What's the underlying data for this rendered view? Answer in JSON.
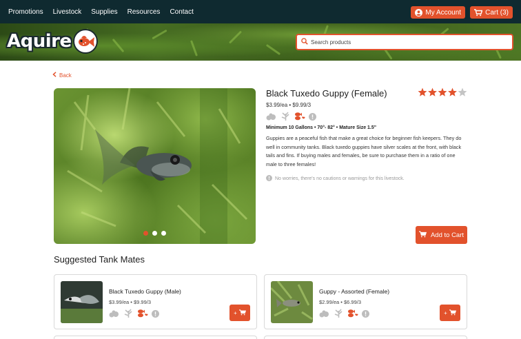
{
  "nav": {
    "links": [
      "Promotions",
      "Livestock",
      "Supplies",
      "Resources",
      "Contact"
    ],
    "account_label": "My Account",
    "cart_label": "Cart (3)"
  },
  "brand": {
    "logo_text": "Aquire"
  },
  "search": {
    "placeholder": "Search products"
  },
  "back_label": "Back",
  "product": {
    "title": "Black Tuxedo Guppy (Female)",
    "rating": 4,
    "rating_max": 5,
    "price": "$3.99/ea • $9.99/3",
    "specs": "Minimum 10 Gallons • 70°- 82° • Mature Size 1.5\"",
    "description": "Guppies are a peaceful fish that make a great choice for beginner fish keepers. They do well in community tanks. Black tuxedo guppies have silver scales at the front, with black tails and fins. If buying males and females, be sure to purchase them in a ratio of one male to three females!",
    "note": "No worries, there's no cautions or warnings for this livestock.",
    "add_to_cart_label": "Add to Cart",
    "active_slide": 1,
    "slide_count": 3
  },
  "suggested": {
    "title": "Suggested Tank Mates",
    "items": [
      {
        "name": "Black Tuxedo Guppy (Male)",
        "price": "$3.99/ea • $9.99/3",
        "add_label": "+"
      },
      {
        "name": "Guppy - Assorted (Female)",
        "price": "$2.99/ea • $6.99/3",
        "add_label": "+"
      }
    ]
  },
  "colors": {
    "accent": "#e2522c",
    "nav_bg": "#0f2a30",
    "star_off": "#c4c4c4"
  }
}
